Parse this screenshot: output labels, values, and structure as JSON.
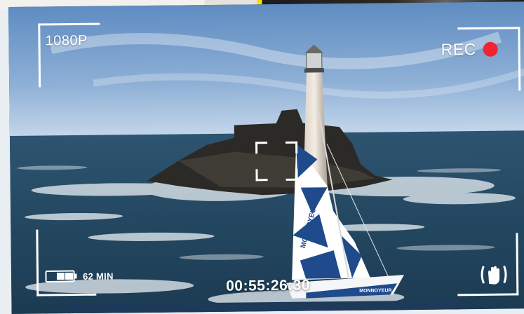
{
  "camera": {
    "resolution": "1080P",
    "rec_label": "REC",
    "battery_label": "62 MIN",
    "timecode": "00:55:26:30"
  },
  "sail": {
    "brand_text": "MONNOYEUR"
  },
  "icons": {
    "record": "record-dot-icon",
    "battery": "battery-icon",
    "stabilize": "hand-stabilize-icon",
    "focus": "focus-bracket-icon"
  },
  "colors": {
    "rec_dot": "#f0232e",
    "overlay": "#ffffff",
    "sail_blue": "#1f4a8c"
  }
}
